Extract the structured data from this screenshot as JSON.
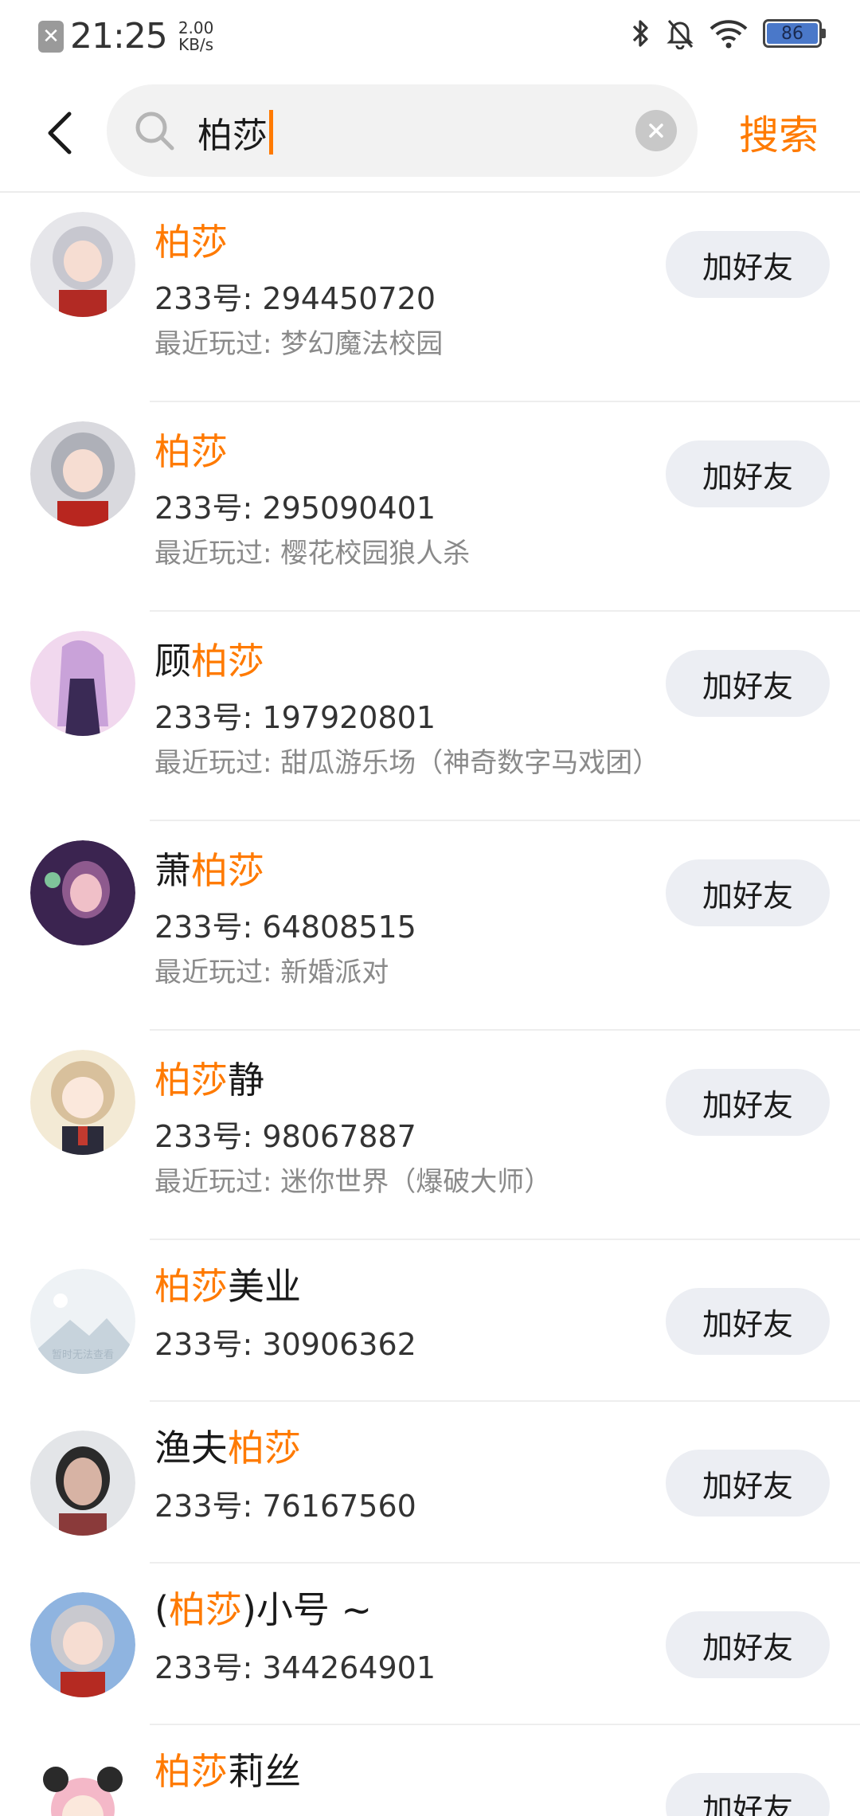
{
  "status_bar": {
    "time": "21:25",
    "speed_value": "2.00",
    "speed_unit": "KB/s",
    "battery": "86"
  },
  "header": {
    "search_query": "柏莎",
    "search_button": "搜索"
  },
  "results": [
    {
      "name_before": "",
      "name_highlight": "柏莎",
      "name_after": "",
      "id_text": "233号: 294450720",
      "recent": "最近玩过: 梦幻魔法校园",
      "button": "加好友",
      "avatar_colors": [
        "#e6e6ea",
        "#c7c7cf",
        "#b22a24"
      ]
    },
    {
      "name_before": "",
      "name_highlight": "柏莎",
      "name_after": "",
      "id_text": "233号: 295090401",
      "recent": "最近玩过: 樱花校园狼人杀",
      "button": "加好友",
      "avatar_colors": [
        "#d9d9de",
        "#aeb0b8",
        "#b8261f"
      ]
    },
    {
      "name_before": "顾",
      "name_highlight": "柏莎",
      "name_after": "",
      "id_text": "233号: 197920801",
      "recent": "最近玩过: 甜瓜游乐场（神奇数字马戏团）",
      "button": "加好友",
      "avatar_colors": [
        "#f1d8ee",
        "#c9a2d9",
        "#3a2a55"
      ]
    },
    {
      "name_before": "萧",
      "name_highlight": "柏莎",
      "name_after": "",
      "id_text": "233号: 64808515",
      "recent": "最近玩过: 新婚派对",
      "button": "加好友",
      "avatar_colors": [
        "#3b2450",
        "#8e5a8e",
        "#f0c0c8"
      ]
    },
    {
      "name_before": "",
      "name_highlight": "柏莎",
      "name_after": "静",
      "id_text": "233号: 98067887",
      "recent": "最近玩过: 迷你世界（爆破大师）",
      "button": "加好友",
      "avatar_colors": [
        "#f3ead5",
        "#d8c09c",
        "#c23a2f"
      ]
    },
    {
      "name_before": "",
      "name_highlight": "柏莎",
      "name_after": "美业",
      "id_text": "233号: 30906362",
      "recent": "",
      "button": "加好友",
      "avatar_colors": [
        "#eef2f5",
        "#c7d3dc",
        "#a9b8c4"
      ],
      "avatar_caption": "暂时无法查看"
    },
    {
      "name_before": "渔夫",
      "name_highlight": "柏莎",
      "name_after": "",
      "id_text": "233号: 76167560",
      "recent": "",
      "button": "加好友",
      "avatar_colors": [
        "#e3e5e8",
        "#d7b3a4",
        "#2a2a2a"
      ]
    },
    {
      "name_before": "(",
      "name_highlight": "柏莎",
      "name_after": ")小号 ~",
      "id_text": "233号: 344264901",
      "recent": "",
      "button": "加好友",
      "avatar_colors": [
        "#8fb4e0",
        "#c9c9cf",
        "#b52a22"
      ]
    },
    {
      "name_before": "",
      "name_highlight": "柏莎",
      "name_after": "莉丝",
      "id_text": "",
      "recent": "",
      "button": "加好友",
      "avatar_colors": [
        "#ffffff",
        "#f4b8c8",
        "#e4849c"
      ]
    }
  ]
}
